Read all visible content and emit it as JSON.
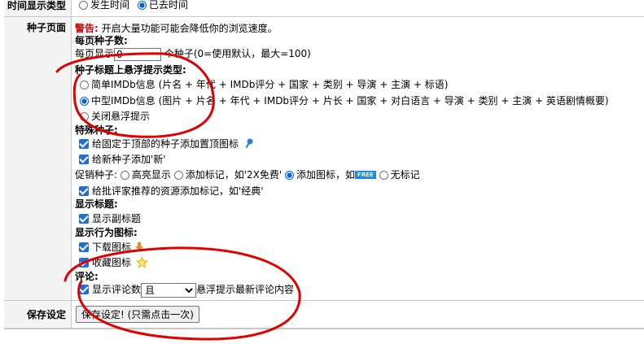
{
  "time_row": {
    "label": "时间显示类型",
    "option_occur": "发生时间",
    "option_elapsed": "已去时间"
  },
  "torrent_page": {
    "label": "种子页面",
    "warning_prefix": "警告:",
    "warning_text": "开启大量功能可能会降低你的浏览速度。",
    "per_page_heading": "每页种子数:",
    "per_page_prefix": "每页显示",
    "per_page_value": "0",
    "per_page_suffix": "个种子(0=使用默认，最大=100)",
    "hover_heading": "种子标题上悬浮提示类型:",
    "hover_options": [
      "简单IMDb信息 (片名 + 年代 + IMDb评分 + 国家 + 类别 + 导演 + 主演 + 标语)",
      "中型IMDb信息 (图片 + 片名 + 年代 + IMDb评分 + 片长 + 国家 + 对白语言 + 导演 + 类别 + 主演 + 英语剧情概要)",
      "关闭悬浮提示"
    ],
    "special_heading": "特殊种子:",
    "pin_icon_label": "给固定于顶部的种子添加置顶图标",
    "new_label": "给新种子添加'新'",
    "promo_prefix": "促销种子:",
    "promo_options": [
      "高亮显示",
      "添加标记，如'2X免费'",
      "添加图标，如",
      "无标记"
    ],
    "free_badge": "FREE",
    "recommend_label": "给批评家推荐的资源添加标记，如'经典'",
    "title_heading": "显示标题:",
    "subtitle_label": "显示副标题",
    "action_heading": "显示行为图标:",
    "download_icon_label": "下载图标",
    "bookmark_icon_label": "收藏图标",
    "comment_heading": "评论:",
    "comment_show_label": "显示评论数",
    "comment_select_value": "且",
    "comment_suffix": "悬浮提示最新评论内容"
  },
  "save_row": {
    "label": "保存设定",
    "button": "保存设定! (只需点击一次)"
  },
  "colors": {
    "warning": "#d00000",
    "accent": "#0b62d6",
    "annotation": "#e00000",
    "free_badge": "#1d8be0"
  },
  "icons": [
    "pin-icon",
    "download-arrow-icon",
    "star-icon"
  ]
}
